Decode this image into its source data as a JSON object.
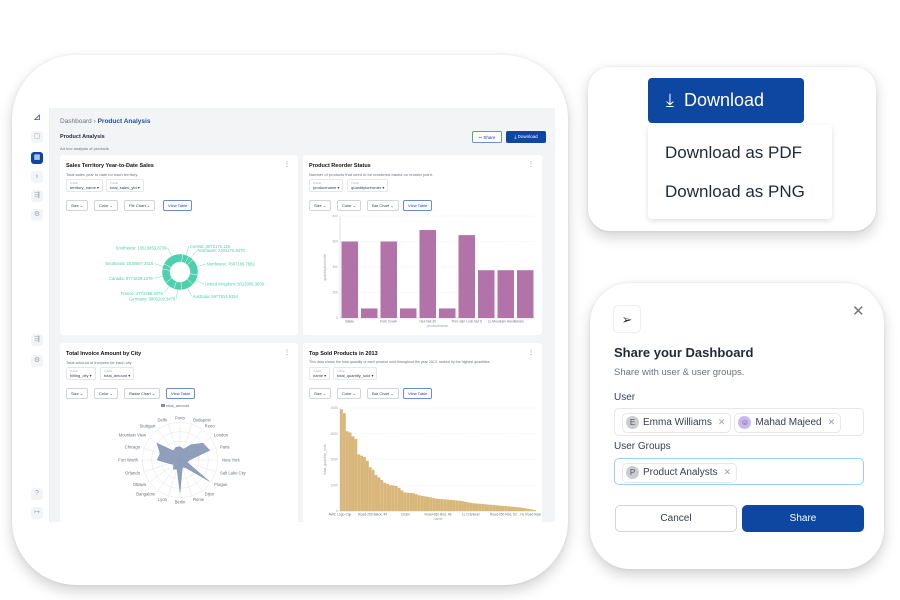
{
  "sidebar": {
    "logo": "logo-icon",
    "items": [
      "chat-icon",
      "dashboard-icon",
      "user-icon",
      "flow-icon",
      "settings-icon",
      "flow-icon",
      "settings-icon",
      "help-icon",
      "logout-icon"
    ]
  },
  "header": {
    "breadcrumb_root": "Dashboard",
    "breadcrumb_current": "Product Analysis",
    "title": "Product Analysis",
    "subtitle": "Ad hoc analysis of products",
    "share_label": "Share",
    "download_label": "Download"
  },
  "common": {
    "x_axis_label": "X Axis",
    "y_axis_label": "Y Axis",
    "size": "Size",
    "color": "Color",
    "view_table": "View Table"
  },
  "cards": [
    {
      "title": "Sales Territory Year-to-Date Sales",
      "desc": "Total sales year to date for each territory.",
      "x": "territory_name",
      "y": "total_sales_ytd",
      "chart": "Pie Chart"
    },
    {
      "title": "Product Reorder Status",
      "desc": "Number of products that need to be reordered based on reorder point.",
      "x": "productname",
      "y": "quantitytoreorder",
      "chart": "Bar Chart"
    },
    {
      "title": "Total Invoice Amount by City",
      "desc": "Total amount of invoices for each city",
      "x": "billing_city",
      "y": "total_amount",
      "chart": "Radar Chart"
    },
    {
      "title": "Top Sold Products in 2013",
      "desc": "This data shows the total quantity of each product sold throughout the year 2013, ranked by the highest quantities.",
      "x": "name",
      "y": "total_quantity_sold",
      "chart": "Bar Chart"
    }
  ],
  "chart_data": [
    {
      "type": "pie",
      "donut": true,
      "color": "#4ecfae",
      "labels": [
        "Central",
        "Northeast",
        "Northwest",
        "United Kingdom",
        "Australia",
        "Germany",
        "France",
        "Canada",
        "Southeast",
        "Southwest"
      ],
      "values": [
        3072175.118,
        2402176.8476,
        7887186.7882,
        5012905.3656,
        5977814.9154,
        3805202.3478,
        4772398.3078,
        6771829.1376,
        2538667.2515,
        10510853.8739
      ],
      "data_labels": [
        "Central: 3072175.118",
        "Northeast: 2402176.8476",
        "Northwest: 7887186.7882",
        "United Kingdom: 5012905.3656",
        "Australia: 5977814.9154",
        "Germany: 3805202.3478",
        "France: 4772398.3078",
        "Canada: 6771829.1376",
        "Southeast: 2538667.2515",
        "Southwest: 10510853.8739"
      ]
    },
    {
      "type": "bar",
      "color": "#b274a8",
      "xlabel": "productname",
      "ylabel": "quantitytoreorder",
      "ylim": [
        0,
        800
      ],
      "yticks": [
        0,
        200,
        400,
        600,
        800
      ],
      "grid": true,
      "categories": [
        "Blade",
        "",
        "Fork Crown",
        "",
        "Hex Nut 20",
        "",
        "Thin-Jam Lock Nut 6",
        "",
        "LL Mountain Handlebars",
        ""
      ],
      "values": [
        600,
        75,
        600,
        75,
        690,
        75,
        650,
        375,
        375,
        375
      ]
    },
    {
      "type": "radar",
      "color": "#7c8fb0",
      "legend": "total_amount",
      "legend_position": "top",
      "rmax": 40,
      "rticks": [
        10,
        20,
        30,
        40
      ],
      "categories": [
        "Porto",
        "Budapest",
        "Reno",
        "London",
        "Paris",
        "New York",
        "Salt Lake City",
        "Prague",
        "Dijon",
        "Rome",
        "Berlin",
        "Lyon",
        "Bangalore",
        "Ottawa",
        "Orlando",
        "Fort Worth",
        "Chicago",
        "Mountain View",
        "Stuttgart",
        "Delhi"
      ],
      "values": [
        14,
        12,
        20,
        30,
        33,
        10,
        8,
        38,
        10,
        8,
        34,
        10,
        12,
        8,
        12,
        24,
        22,
        30,
        12,
        14
      ]
    },
    {
      "type": "bar",
      "color": "#d9b77a",
      "xlabel": "name",
      "ylabel": "total_quantity_sold",
      "ylim": [
        0,
        4000
      ],
      "yticks": [
        0,
        1000,
        2000,
        3000,
        4000
      ],
      "grid": true,
      "tick_labels": [
        "AWC Logo Cap",
        "Road-250 Black, 44",
        "Chain",
        "Road-650 Red, 48",
        "LL Crankset",
        "Road-250 Red, 52",
        "HL Road Rear Wheel"
      ],
      "values": [
        3950,
        3800,
        3100,
        3050,
        2900,
        2800,
        2200,
        2150,
        2100,
        1950,
        1700,
        1600,
        1400,
        1300,
        1200,
        1100,
        1050,
        1000,
        990,
        970,
        900,
        800,
        720,
        710,
        700,
        690,
        650,
        610,
        590,
        570,
        550,
        530,
        500,
        480,
        470,
        460,
        450,
        440,
        430,
        420,
        410,
        400,
        380,
        360,
        340,
        320,
        300,
        290,
        280,
        270,
        260,
        250,
        240,
        230,
        220,
        210,
        200,
        190,
        180,
        170,
        160,
        150,
        140,
        120,
        100,
        80,
        60,
        40
      ]
    }
  ],
  "download_menu": {
    "button": "Download",
    "items": [
      "Download as PDF",
      "Download as PNG"
    ]
  },
  "share_dialog": {
    "icon": "send-icon",
    "title": "Share your Dashboard",
    "subtitle": "Share with user & user groups.",
    "user_label": "User",
    "users": [
      {
        "initial": "E",
        "name": "Emma Williams"
      },
      {
        "initial": "",
        "name": "Mahad Majeed"
      }
    ],
    "groups_label": "User Groups",
    "groups": [
      {
        "initial": "P",
        "name": "Product Analysts"
      }
    ],
    "cancel": "Cancel",
    "share": "Share"
  },
  "colors": {
    "brand": "#0d47a1"
  }
}
